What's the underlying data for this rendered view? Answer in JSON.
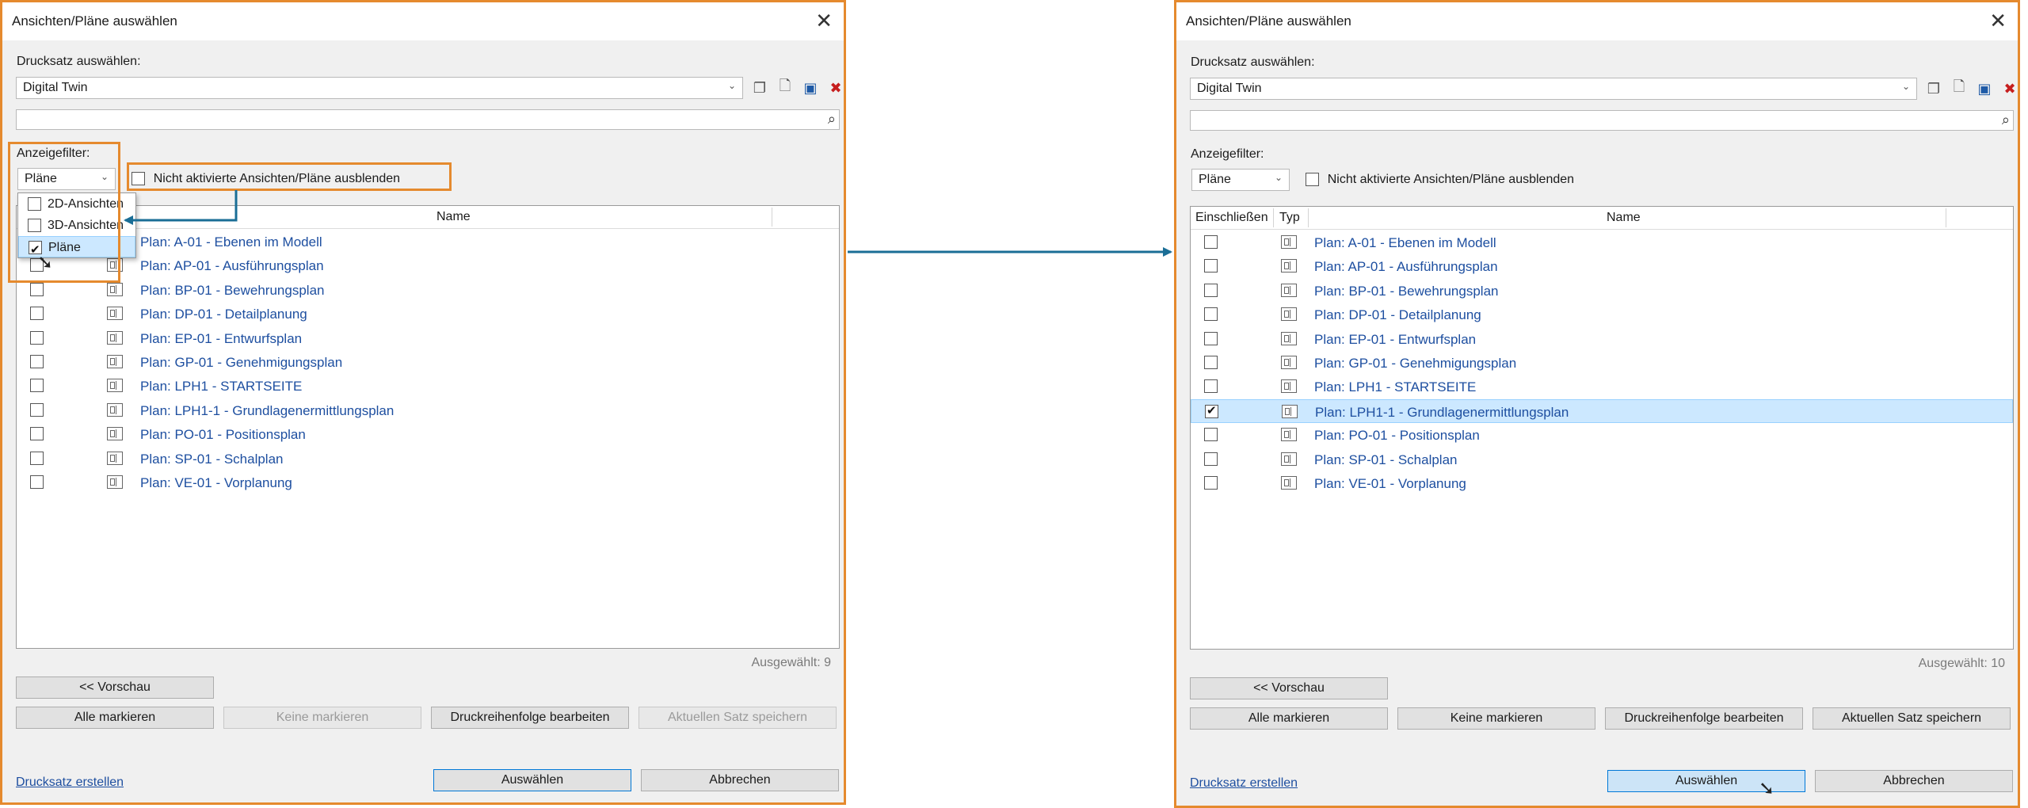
{
  "colors": {
    "highlight": "#e58a2e",
    "arrow": "#1a6e96",
    "link": "#1e4fa0",
    "selection": "#cce8ff"
  },
  "left": {
    "title": "Ansichten/Pläne auswählen",
    "drucksatz_label": "Drucksatz auswählen:",
    "drucksatz_value": "Digital Twin",
    "anzeigefilter_label": "Anzeigefilter:",
    "filter_value": "Pläne",
    "hide_label": "Nicht aktivierte Ansichten/Pläne ausblenden",
    "filter_options": [
      {
        "label": "2D-Ansichten",
        "checked": false
      },
      {
        "label": "3D-Ansichten",
        "checked": false
      },
      {
        "label": "Pläne",
        "checked": true
      }
    ],
    "col_name": "Name",
    "selected_count": "Ausgewählt: 9",
    "preview_btn": "<< Vorschau",
    "mark_all": "Alle markieren",
    "mark_none": "Keine markieren",
    "print_order": "Druckreihenfolge bearbeiten",
    "save_set": "Aktuellen Satz speichern",
    "create_link": "Drucksatz erstellen",
    "select_btn": "Auswählen",
    "cancel_btn": "Abbrechen",
    "rows": [
      {
        "name": "Plan: A-01 - Ebenen im Modell",
        "checked": false
      },
      {
        "name": "Plan: AP-01 - Ausführungsplan",
        "checked": false
      },
      {
        "name": "Plan: BP-01 - Bewehrungsplan",
        "checked": false
      },
      {
        "name": "Plan: DP-01 - Detailplanung",
        "checked": false
      },
      {
        "name": "Plan: EP-01 - Entwurfsplan",
        "checked": false
      },
      {
        "name": "Plan: GP-01 - Genehmigungsplan",
        "checked": false
      },
      {
        "name": "Plan: LPH1 - STARTSEITE",
        "checked": false
      },
      {
        "name": "Plan: LPH1-1 - Grundlagenermittlungsplan",
        "checked": false
      },
      {
        "name": "Plan: PO-01 - Positionsplan",
        "checked": false
      },
      {
        "name": "Plan: SP-01 - Schalplan",
        "checked": false
      },
      {
        "name": "Plan: VE-01 - Vorplanung",
        "checked": false
      }
    ]
  },
  "right": {
    "title": "Ansichten/Pläne auswählen",
    "drucksatz_label": "Drucksatz auswählen:",
    "drucksatz_value": "Digital Twin",
    "anzeigefilter_label": "Anzeigefilter:",
    "filter_value": "Pläne",
    "hide_label": "Nicht aktivierte Ansichten/Pläne ausblenden",
    "col_include": "Einschließen",
    "col_type": "Typ",
    "col_name": "Name",
    "selected_count": "Ausgewählt: 10",
    "preview_btn": "<< Vorschau",
    "mark_all": "Alle markieren",
    "mark_none": "Keine markieren",
    "print_order": "Druckreihenfolge bearbeiten",
    "save_set": "Aktuellen Satz speichern",
    "create_link": "Drucksatz erstellen",
    "select_btn": "Auswählen",
    "cancel_btn": "Abbrechen",
    "rows": [
      {
        "name": "Plan: A-01 - Ebenen im Modell",
        "checked": false
      },
      {
        "name": "Plan: AP-01 - Ausführungsplan",
        "checked": false
      },
      {
        "name": "Plan: BP-01 - Bewehrungsplan",
        "checked": false
      },
      {
        "name": "Plan: DP-01 - Detailplanung",
        "checked": false
      },
      {
        "name": "Plan: EP-01 - Entwurfsplan",
        "checked": false
      },
      {
        "name": "Plan: GP-01 - Genehmigungsplan",
        "checked": false
      },
      {
        "name": "Plan: LPH1 - STARTSEITE",
        "checked": false
      },
      {
        "name": "Plan: LPH1-1 - Grundlagenermittlungsplan",
        "checked": true,
        "selected": true
      },
      {
        "name": "Plan: PO-01 - Positionsplan",
        "checked": false
      },
      {
        "name": "Plan: SP-01 - Schalplan",
        "checked": false
      },
      {
        "name": "Plan: VE-01 - Vorplanung",
        "checked": false
      }
    ]
  }
}
